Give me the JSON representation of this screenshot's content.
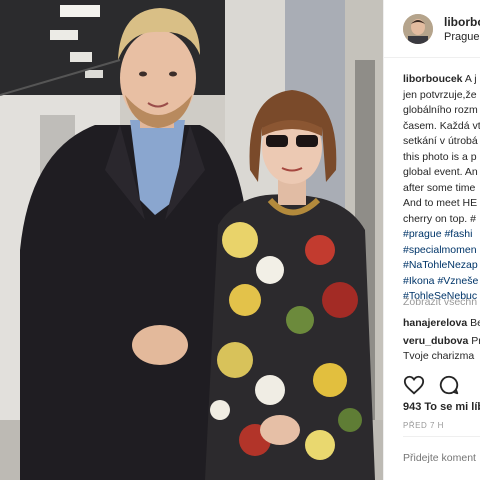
{
  "post": {
    "username": "liborbo",
    "location": "Prague,",
    "caption": {
      "author": "liborboucek",
      "lines": [
        " A j",
        "jen potvrzuje,že",
        "globálního rozm",
        "časem. Každá vt",
        "setkání v útrobá",
        "this photo is a p",
        "global event. An",
        "after some time",
        "And to meet HE",
        "cherry on top. #"
      ],
      "hashtags": [
        "#prague #fashi",
        "#specialmomen",
        "#NaTohleNezap",
        "#Ikona #Vzneše",
        "#TohleSeNebuc"
      ]
    },
    "view_all_comments": "Zobrazit všechn",
    "comments": [
      {
        "user": "hanajerelova",
        "text": " Be"
      },
      {
        "user": "veru_dubova",
        "text": " Pr",
        "text2": "Tvoje charizma"
      }
    ],
    "likes": "943 To se mi líb",
    "time": "PŘED 7 H",
    "add_comment_placeholder": "Přidejte koment"
  },
  "icons": {
    "like": "heart-icon",
    "comment": "comment-icon"
  },
  "colors": {
    "hashtag": "#003569",
    "muted": "#999999",
    "text": "#262626",
    "divider": "#efefef"
  }
}
